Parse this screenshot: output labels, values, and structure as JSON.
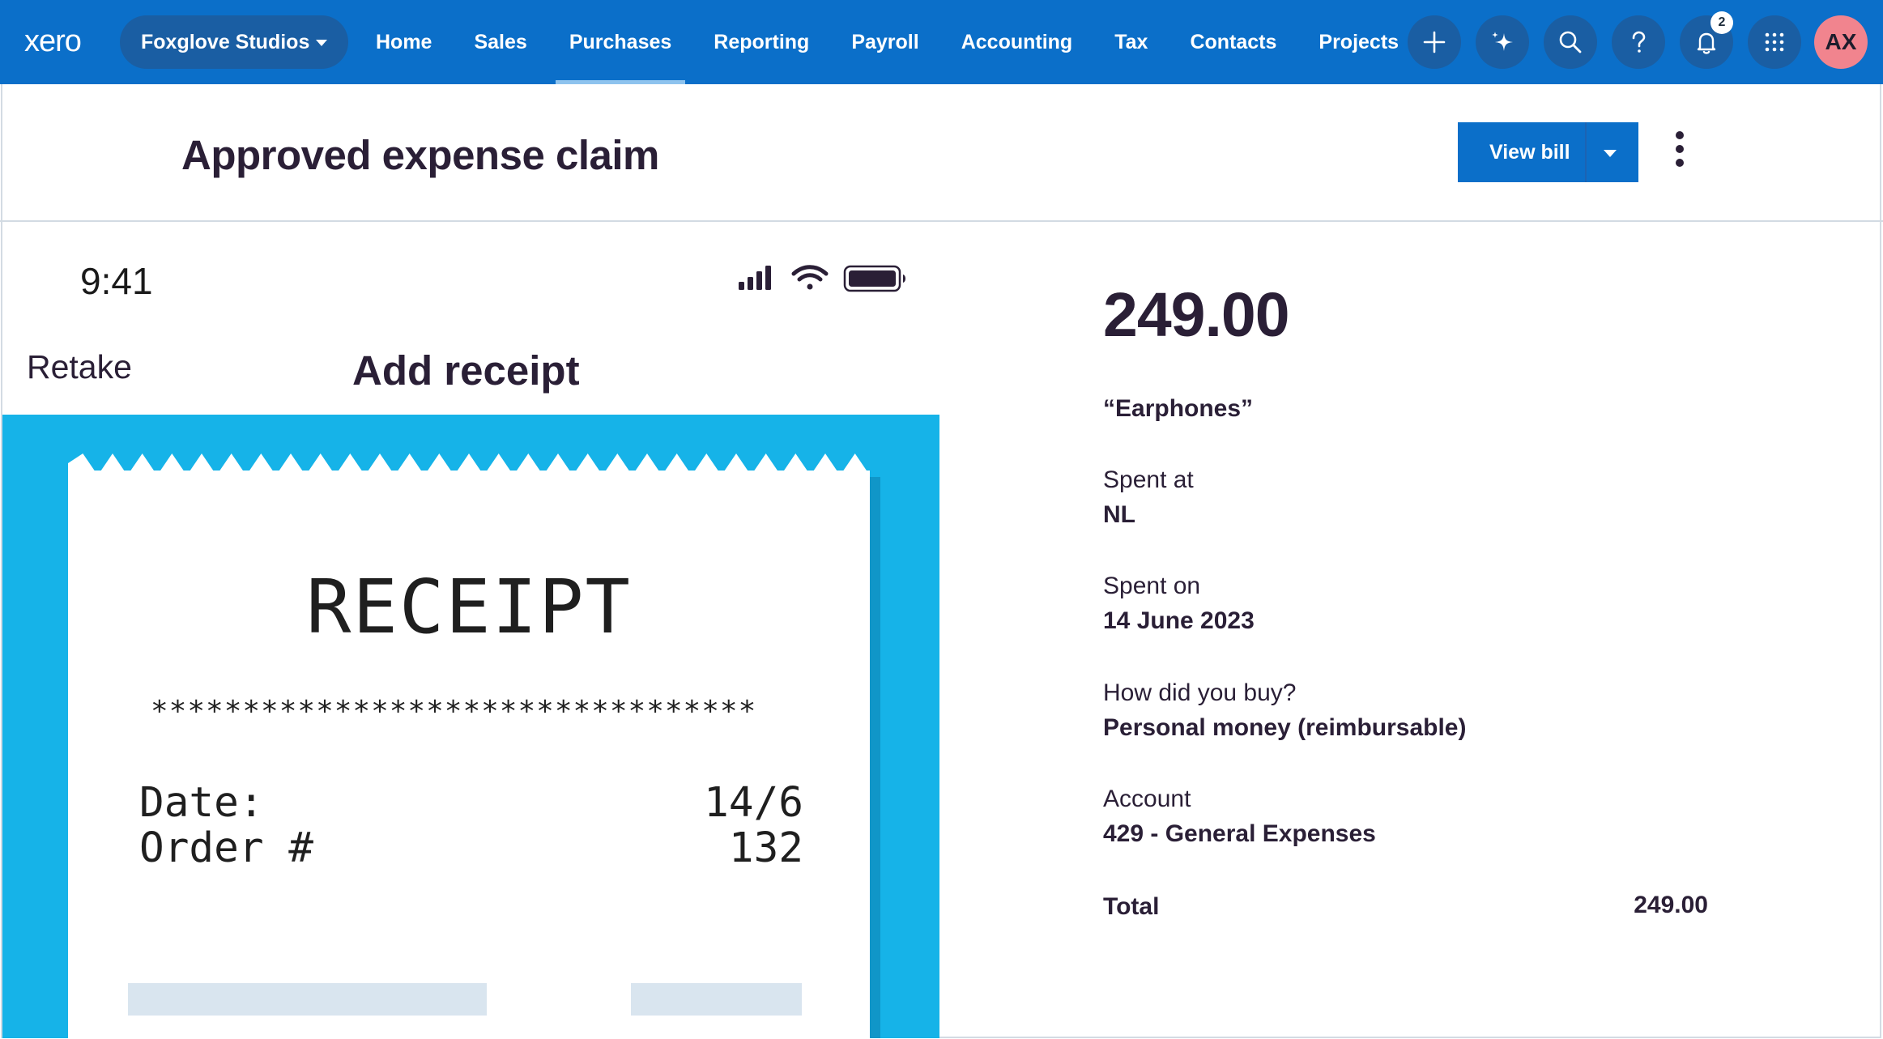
{
  "topnav": {
    "logo": "xero",
    "org_name": "Foxglove Studios",
    "links": [
      {
        "label": "Home",
        "active": false
      },
      {
        "label": "Sales",
        "active": false
      },
      {
        "label": "Purchases",
        "active": true
      },
      {
        "label": "Reporting",
        "active": false
      },
      {
        "label": "Payroll",
        "active": false
      },
      {
        "label": "Accounting",
        "active": false
      },
      {
        "label": "Tax",
        "active": false
      },
      {
        "label": "Contacts",
        "active": false
      },
      {
        "label": "Projects",
        "active": false
      }
    ],
    "icons": [
      "plus-icon",
      "sparkle-icon",
      "search-icon",
      "help-icon",
      "bell-icon",
      "app-grid-icon"
    ],
    "notification_count": "2",
    "avatar_initials": "AX",
    "colors": {
      "bar": "#0b6fc9",
      "pill": "#1a5ea3",
      "avatar": "#f1848e"
    }
  },
  "header": {
    "title": "Approved expense claim",
    "view_bill_label": "View bill"
  },
  "phone": {
    "time": "9:41",
    "retake_label": "Retake",
    "title": "Add receipt",
    "receipt": {
      "heading": "RECEIPT",
      "separator": "*********************************",
      "rows": [
        {
          "label": "Date:",
          "value": "14/6"
        },
        {
          "label": "Order #",
          "value": "132"
        }
      ]
    },
    "colors": {
      "background": "#16b3e8"
    }
  },
  "details": {
    "amount": "249.00",
    "description": "“Earphones”",
    "fields": [
      {
        "label": "Spent at",
        "value": "NL"
      },
      {
        "label": "Spent on",
        "value": "14 June 2023"
      },
      {
        "label": "How did you buy?",
        "value": "Personal money (reimbursable)"
      },
      {
        "label": "Account",
        "value": "429 - General Expenses"
      }
    ],
    "total_label": "Total",
    "total_value": "249.00"
  }
}
